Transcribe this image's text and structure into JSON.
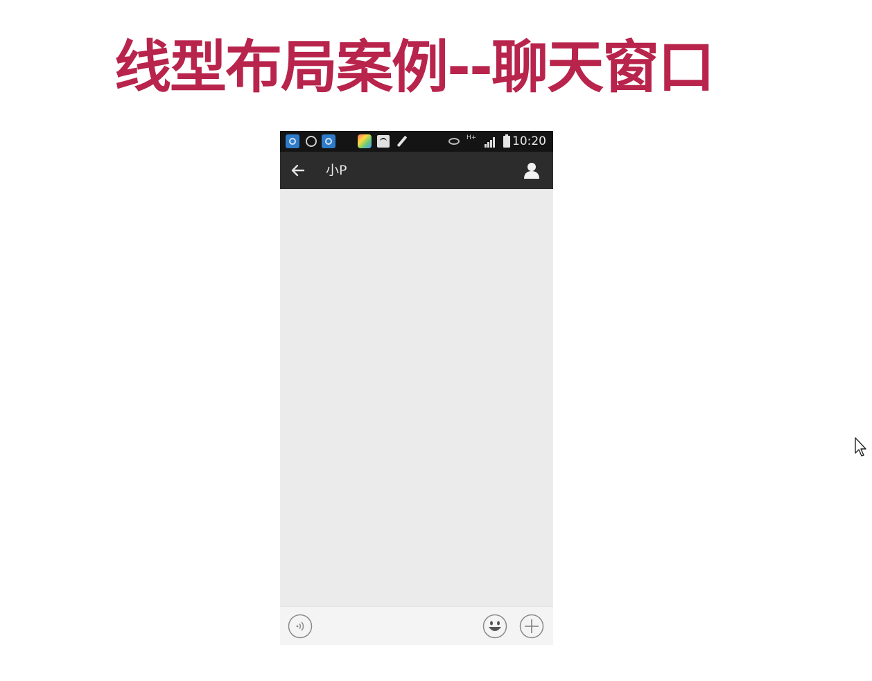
{
  "slide": {
    "title": "线型布局案例--聊天窗口"
  },
  "status_bar": {
    "network_label": "H+",
    "time": "10:20",
    "icons": [
      "notification-app-icon",
      "face-icon",
      "notification-app-icon",
      "colorful-app-icon",
      "wifi-app-icon",
      "pen-icon",
      "eye-icon",
      "network-icon",
      "signal-icon",
      "battery-icon"
    ]
  },
  "action_bar": {
    "title": "小P",
    "back_icon": "arrow-left-icon",
    "contact_icon": "person-icon"
  },
  "input_bar": {
    "voice_icon": "voice-icon",
    "emoji_icon": "smiley-icon",
    "more_icon": "plus-icon"
  },
  "colors": {
    "title_color": "#b8244c",
    "status_bar_bg": "#141414",
    "action_bar_bg": "#2c2c2c",
    "chat_bg": "#ebebeb",
    "input_bar_bg": "#f4f4f4"
  }
}
